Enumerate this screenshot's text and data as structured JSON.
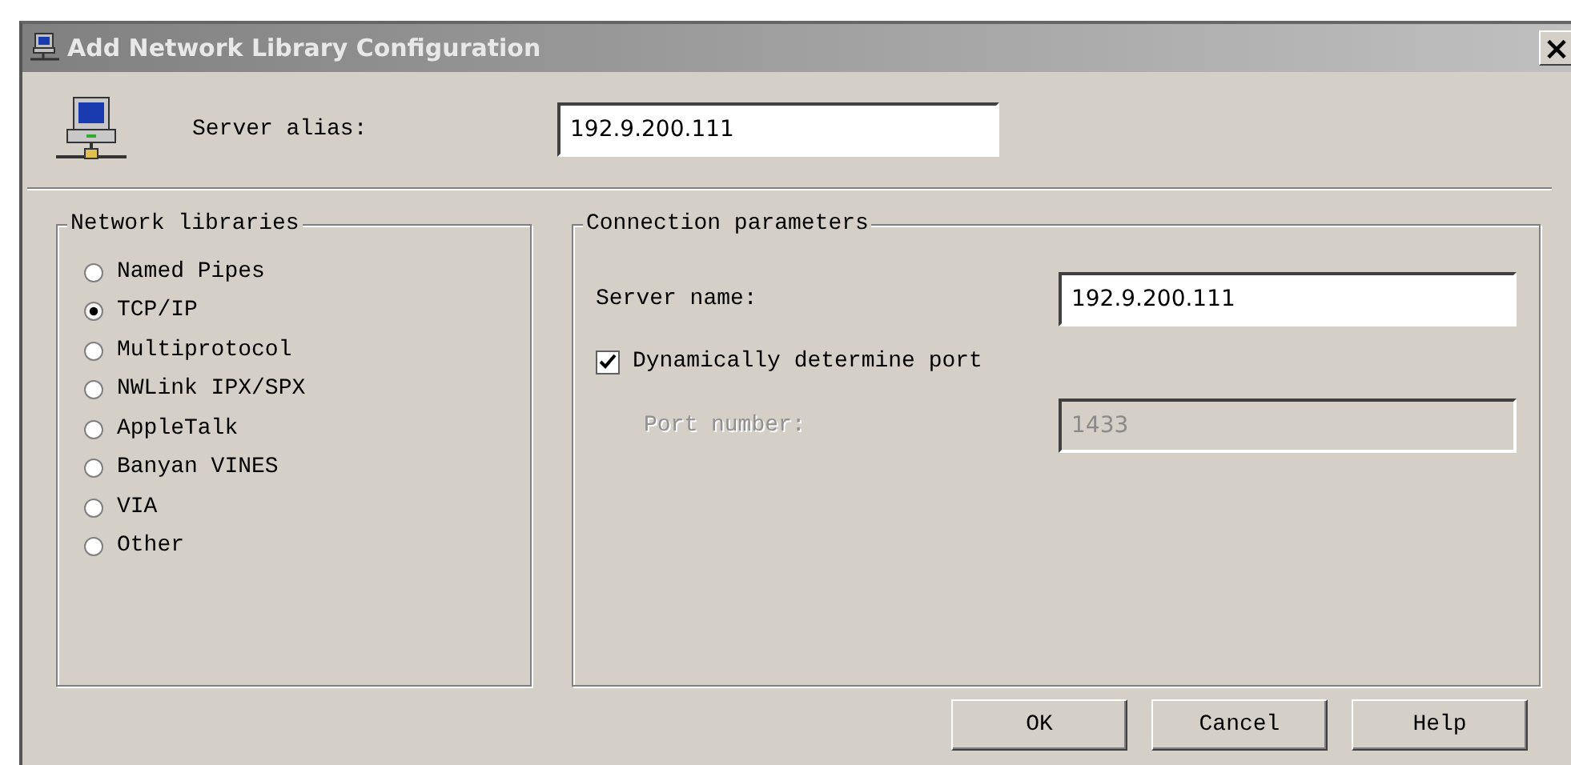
{
  "window": {
    "title": "Add Network Library Configuration",
    "close": "×"
  },
  "server_alias": {
    "label": "Server alias:",
    "value": "192.9.200.111"
  },
  "network_libraries": {
    "title": "Network libraries",
    "options": [
      {
        "label": "Named Pipes",
        "selected": false
      },
      {
        "label": "TCP/IP",
        "selected": true
      },
      {
        "label": "Multiprotocol",
        "selected": false
      },
      {
        "label": "NWLink IPX/SPX",
        "selected": false
      },
      {
        "label": "AppleTalk",
        "selected": false
      },
      {
        "label": "Banyan VINES",
        "selected": false
      },
      {
        "label": "VIA",
        "selected": false
      },
      {
        "label": "Other",
        "selected": false
      }
    ]
  },
  "connection_parameters": {
    "title": "Connection parameters",
    "server_name": {
      "label": "Server name:",
      "value": "192.9.200.111"
    },
    "dynamic_port": {
      "label": "Dynamically determine port",
      "checked": true
    },
    "port_number": {
      "label": "Port number:",
      "value": "1433",
      "disabled": true
    }
  },
  "buttons": [
    "OK",
    "Cancel",
    "Help"
  ]
}
